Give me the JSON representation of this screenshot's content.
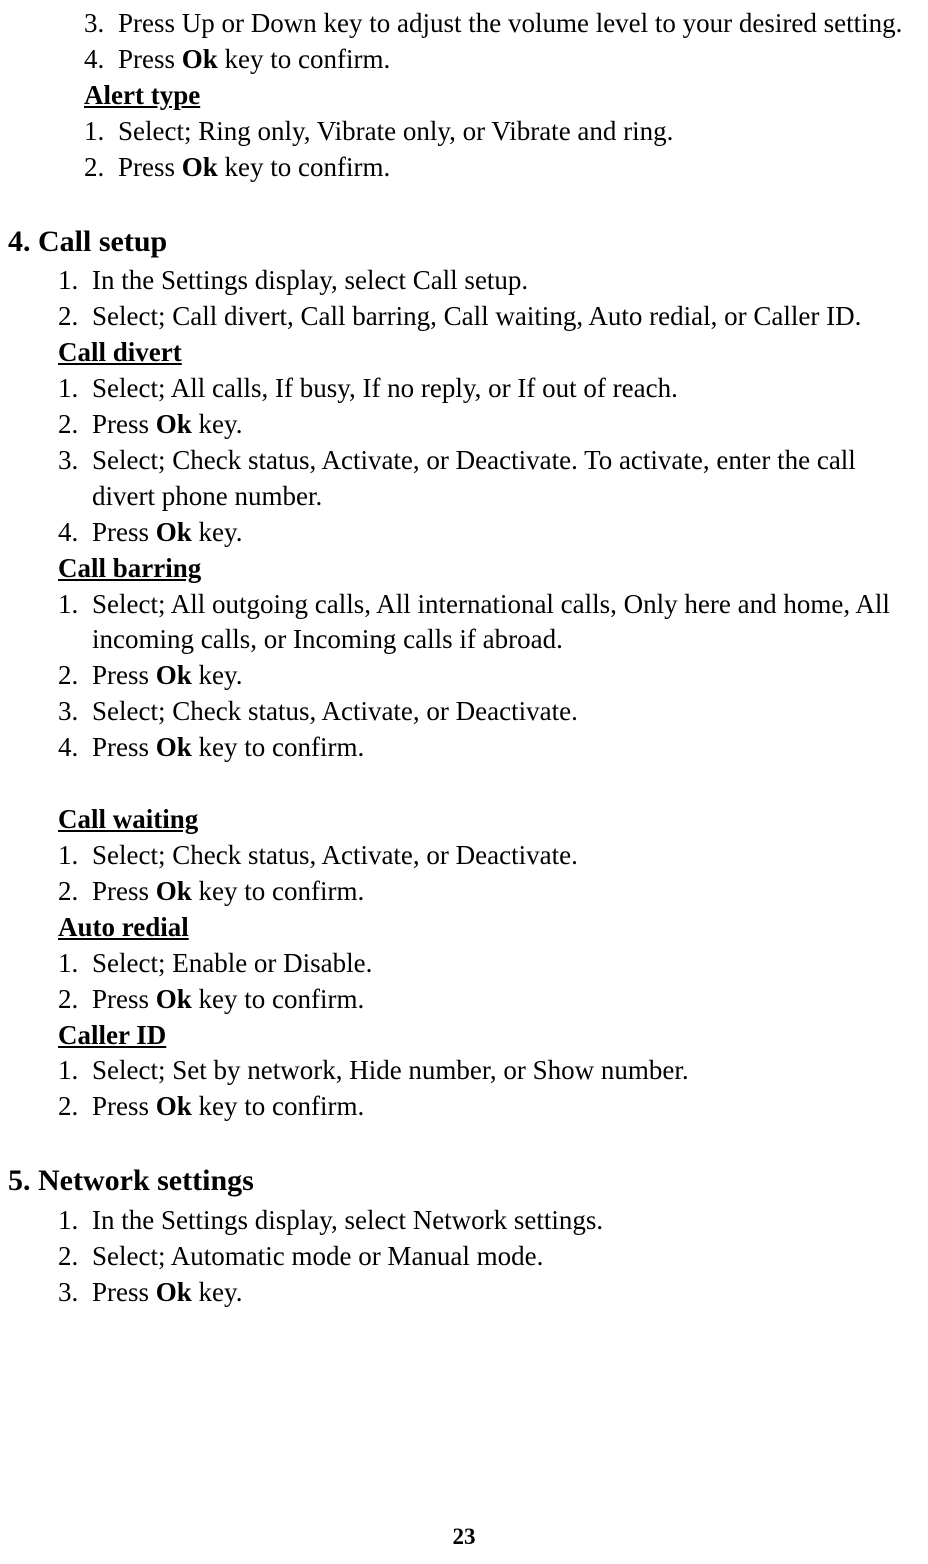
{
  "page_number": "23",
  "intro_block": {
    "steps": [
      {
        "n": "3.",
        "text": "Press Up or Down key to adjust the volume level to your desired setting."
      },
      {
        "n": "4.",
        "prefix": "Press ",
        "bold": "Ok",
        "suffix": " key to confirm."
      }
    ],
    "alert_type": {
      "heading": "Alert type",
      "steps": [
        {
          "n": "1.",
          "text": "Select; Ring only, Vibrate only, or Vibrate and ring."
        },
        {
          "n": "2.",
          "prefix": "Press ",
          "bold": "Ok",
          "suffix": " key to confirm."
        }
      ]
    }
  },
  "call_setup": {
    "heading": "4. Call setup",
    "steps": [
      {
        "n": "1.",
        "text": "In the Settings display, select Call setup."
      },
      {
        "n": "2.",
        "text": "Select; Call divert, Call barring, Call waiting, Auto redial, or Caller ID."
      }
    ],
    "call_divert": {
      "heading": "Call divert",
      "steps": [
        {
          "n": "1.",
          "text": "Select; All calls, If busy, If no reply, or If out of reach."
        },
        {
          "n": "2.",
          "prefix": "Press ",
          "bold": "Ok",
          "suffix": " key."
        },
        {
          "n": "3.",
          "text": "Select; Check status, Activate, or Deactivate. To activate, enter the call divert phone number."
        },
        {
          "n": "4.",
          "prefix": "Press ",
          "bold": "Ok",
          "suffix": " key."
        }
      ]
    },
    "call_barring": {
      "heading": "Call barring",
      "steps": [
        {
          "n": "1.",
          "text": "Select; All outgoing calls, All international calls, Only here and home, All incoming calls, or Incoming calls if abroad."
        },
        {
          "n": "2.",
          "prefix": "Press ",
          "bold": "Ok",
          "suffix": " key."
        },
        {
          "n": "3.",
          "text": "Select; Check status, Activate, or Deactivate."
        },
        {
          "n": "4.",
          "prefix": "Press ",
          "bold": "Ok",
          "suffix": " key to confirm."
        }
      ]
    },
    "call_waiting": {
      "heading": "Call waiting",
      "steps": [
        {
          "n": "1.",
          "text": "Select; Check status, Activate, or Deactivate."
        },
        {
          "n": "2.",
          "prefix": "Press ",
          "bold": "Ok",
          "suffix": " key to confirm."
        }
      ]
    },
    "auto_redial": {
      "heading": "Auto redial",
      "steps": [
        {
          "n": "1.",
          "text": "Select; Enable or Disable."
        },
        {
          "n": "2.",
          "prefix": "Press ",
          "bold": "Ok",
          "suffix": " key to confirm."
        }
      ]
    },
    "caller_id": {
      "heading": "Caller ID",
      "steps": [
        {
          "n": "1.",
          "text": "Select; Set by network, Hide number, or Show number."
        },
        {
          "n": "2.",
          "prefix": "Press ",
          "bold": "Ok",
          "suffix": " key to confirm."
        }
      ]
    }
  },
  "network": {
    "heading": "5. Network settings",
    "steps": [
      {
        "n": "1.",
        "text": "In the Settings display, select Network settings."
      },
      {
        "n": "2.",
        "text": "Select; Automatic mode or Manual mode."
      },
      {
        "n": "3.",
        "prefix": "Press ",
        "bold": "Ok",
        "suffix": " key."
      }
    ]
  }
}
